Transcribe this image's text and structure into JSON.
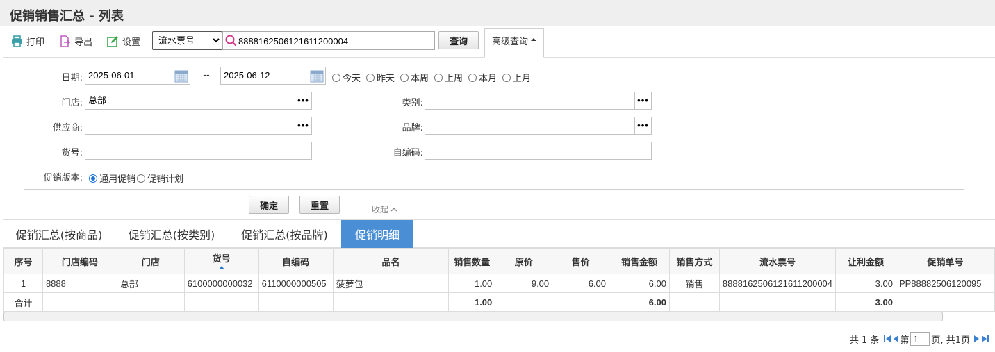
{
  "page": {
    "title": "促销销售汇总 - 列表"
  },
  "toolbar": {
    "print_label": "打印",
    "export_label": "导出",
    "settings_label": "设置",
    "search_field_selected": "流水票号",
    "search_value": "8888162506121611200004",
    "query_label": "查询",
    "advanced_label": "高级查询"
  },
  "filters": {
    "date_label": "日期:",
    "date_from": "2025-06-01",
    "date_sep": "--",
    "date_to": "2025-06-12",
    "quick_dates": [
      "今天",
      "昨天",
      "本周",
      "上周",
      "本月",
      "上月"
    ],
    "store_label": "门店:",
    "store_value": "总部",
    "category_label": "类别:",
    "category_value": "",
    "supplier_label": "供应商:",
    "supplier_value": "",
    "brand_label": "品牌:",
    "brand_value": "",
    "sku_label": "货号:",
    "sku_value": "",
    "selfcode_label": "自编码:",
    "selfcode_value": "",
    "version_label": "促销版本:",
    "version_options": [
      "通用促销",
      "促销计划"
    ],
    "version_selected": "通用促销",
    "confirm_label": "确定",
    "reset_label": "重置",
    "collapse_label": "收起"
  },
  "tabs": [
    {
      "label": "促销汇总(按商品)",
      "active": false
    },
    {
      "label": "促销汇总(按类别)",
      "active": false
    },
    {
      "label": "促销汇总(按品牌)",
      "active": false
    },
    {
      "label": "促销明细",
      "active": true
    }
  ],
  "table": {
    "columns": [
      "序号",
      "门店编码",
      "门店",
      "货号",
      "自编码",
      "品名",
      "销售数量",
      "原价",
      "售价",
      "销售金额",
      "销售方式",
      "流水票号",
      "让利金额",
      "促销单号"
    ],
    "sorted_column": "货号",
    "rows": [
      [
        "1",
        "8888",
        "总部",
        "6100000000032",
        "6110000000505",
        "菠萝包",
        "1.00",
        "9.00",
        "6.00",
        "6.00",
        "销售",
        "8888162506121611200004",
        "3.00",
        "PP88882506120095"
      ]
    ],
    "total_row": [
      "合计",
      "",
      "",
      "",
      "",
      "",
      "1.00",
      "",
      "",
      "6.00",
      "",
      "",
      "3.00",
      ""
    ]
  },
  "pager": {
    "total_text": "共 1 条",
    "page_prefix": "第",
    "page_value": "1",
    "page_suffix": "页, 共1页"
  },
  "colors": {
    "accent": "#4a8fd6",
    "sort_icon": "#2b78d0"
  }
}
